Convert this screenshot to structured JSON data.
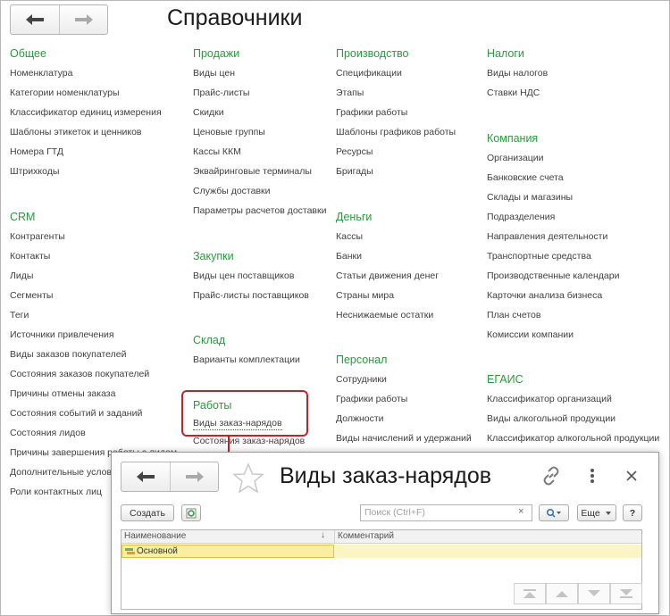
{
  "page_title": "Справочники",
  "groups": {
    "general": {
      "title": "Общее",
      "items": [
        "Номенклатура",
        "Категории номенклатуры",
        "Классификатор единиц измерения",
        "Шаблоны этикеток и ценников",
        "Номера ГТД",
        "Штрихкоды"
      ]
    },
    "crm": {
      "title": "CRM",
      "items": [
        "Контрагенты",
        "Контакты",
        "Лиды",
        "Сегменты",
        "Теги",
        "Источники привлечения",
        "Виды заказов покупателей",
        "Состояния заказов покупателей",
        "Причины отмены заказа",
        "Состояния событий и заданий",
        "Состояния лидов",
        "Причины завершения работы с лидом",
        "Дополнительные услов",
        "Роли контактных лиц"
      ]
    },
    "sales": {
      "title": "Продажи",
      "items": [
        "Виды цен",
        "Прайс-листы",
        "Скидки",
        "Ценовые группы",
        "Кассы ККМ",
        "Эквайринговые терминалы",
        "Службы доставки",
        "Параметры расчетов доставки"
      ]
    },
    "purchases": {
      "title": "Закупки",
      "items": [
        "Виды цен поставщиков",
        "Прайс-листы поставщиков"
      ]
    },
    "warehouse": {
      "title": "Склад",
      "items": [
        "Варианты комплектации"
      ]
    },
    "works": {
      "title": "Работы",
      "items": [
        "Виды заказ-нарядов",
        "Состояния заказ-нарядов"
      ]
    },
    "production": {
      "title": "Производство",
      "items": [
        "Спецификации",
        "Этапы",
        "Графики работы",
        "Шаблоны графиков работы",
        "Ресурсы",
        "Бригады"
      ]
    },
    "money": {
      "title": "Деньги",
      "items": [
        "Кассы",
        "Банки",
        "Статьи движения денег",
        "Страны мира",
        "Неснижаемые остатки"
      ]
    },
    "staff": {
      "title": "Персонал",
      "items": [
        "Сотрудники",
        "Графики работы",
        "Должности",
        "Виды начислений и удержаний"
      ]
    },
    "taxes": {
      "title": "Налоги",
      "items": [
        "Виды налогов",
        "Ставки НДС"
      ]
    },
    "company": {
      "title": "Компания",
      "items": [
        "Организации",
        "Банковские счета",
        "Склады и магазины",
        "Подразделения",
        "Направления деятельности",
        "Транспортные средства",
        "Производственные календари",
        "Карточки анализа бизнеса",
        "План счетов",
        "Комиссии компании"
      ]
    },
    "egais": {
      "title": "ЕГАИС",
      "items": [
        "Классификатор организаций",
        "Виды алкогольной продукции",
        "Классификатор алкогольной продукции"
      ]
    }
  },
  "sub_window": {
    "title": "Виды заказ-нарядов",
    "create_label": "Создать",
    "search_placeholder": "Поиск (Ctrl+F)",
    "search_clear": "×",
    "more_label": "Еще",
    "help_label": "?",
    "columns": [
      "Наименование",
      "Комментарий"
    ],
    "sort_indicator": "↓",
    "rows": [
      {
        "name": "Основной",
        "comment": ""
      }
    ]
  },
  "colors": {
    "group_title": "#2a9a3e",
    "highlight": "#c0232c",
    "selected_row": "#fbeea0"
  },
  "icons": [
    "back-arrow-icon",
    "forward-arrow-icon",
    "star-icon",
    "link-icon",
    "more-vertical-icon",
    "close-icon",
    "refresh-icon",
    "search-icon",
    "first-page-icon",
    "prev-page-icon",
    "next-page-icon",
    "last-page-icon",
    "catalog-item-icon"
  ]
}
